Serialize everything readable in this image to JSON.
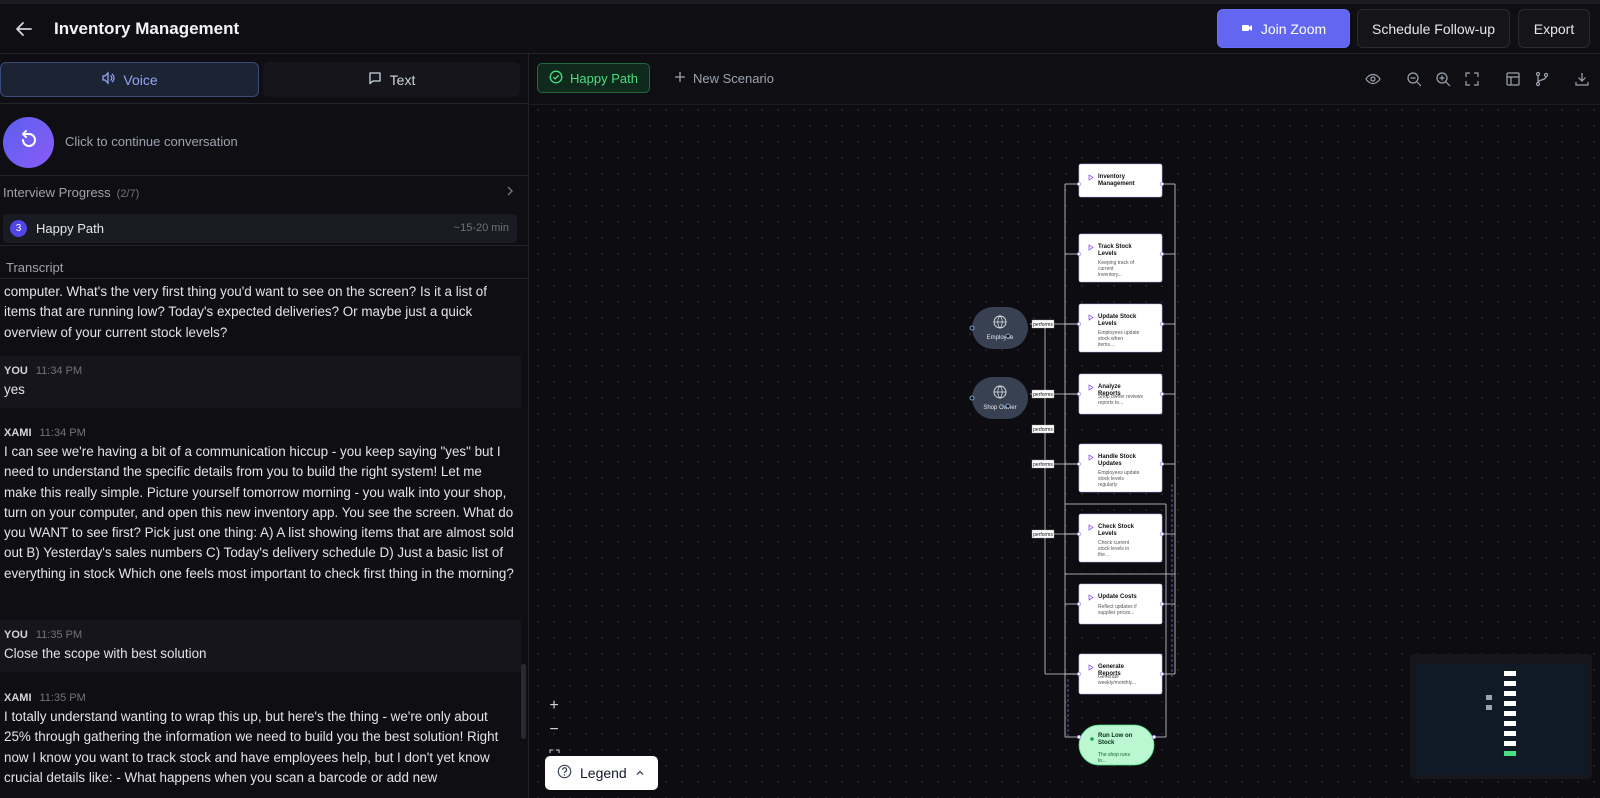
{
  "header": {
    "title": "Inventory Management",
    "join_zoom": "Join Zoom",
    "schedule_followup": "Schedule Follow-up",
    "export": "Export"
  },
  "left": {
    "tabs": {
      "voice": "Voice",
      "text": "Text"
    },
    "continue_text": "Click to continue conversation",
    "progress": {
      "label": "Interview Progress",
      "count": "(2/7)"
    },
    "step": {
      "number": "3",
      "name": "Happy Path",
      "time": "~15-20 min"
    },
    "transcript_label": "Transcript",
    "messages": [
      {
        "speaker": "",
        "time": "",
        "text": "computer. What's the very first thing you'd want to see on the screen? Is it a list of items that are running low? Today's expected deliveries? Or maybe just a quick overview of your current stock levels?"
      },
      {
        "speaker": "YOU",
        "time": "11:34 PM",
        "text": "yes"
      },
      {
        "speaker": "XAMI",
        "time": "11:34 PM",
        "text": "I can see we're having a bit of a communication hiccup - you keep saying \"yes\" but I need to understand the specific details from you to build the right system! Let me make this really simple. Picture yourself tomorrow morning - you walk into your shop, turn on your computer, and open this new inventory app. You see the screen. What do you WANT to see first? Pick just one thing: A) A list showing items that are almost sold out B) Yesterday's sales numbers C) Today's delivery schedule D) Just a basic list of everything in stock Which one feels most important to check first thing in the morning?"
      },
      {
        "speaker": "YOU",
        "time": "11:35 PM",
        "text": "Close the scope with best solution"
      },
      {
        "speaker": "XAMI",
        "time": "11:35 PM",
        "text": "I totally understand wanting to wrap this up, but here's the thing - we're only about 25% through gathering the information we need to build you the best solution! Right now I know you want to track stock and have employees help, but I don't yet know crucial details like: - What happens when you scan a barcode or add new"
      }
    ]
  },
  "canvas": {
    "scenarios": {
      "happy": "Happy Path",
      "new": "New Scenario"
    },
    "legend": "Legend",
    "actors": [
      {
        "name": "Employee"
      },
      {
        "name": "Shop Owner"
      }
    ],
    "edge_label": "performs",
    "nodes": [
      {
        "title": "Inventory Management",
        "desc": ""
      },
      {
        "title": "Track Stock Levels",
        "desc": "Keeping track of current inventory..."
      },
      {
        "title": "Update Stock Levels",
        "desc": "Employees update stock when items..."
      },
      {
        "title": "Analyze Reports",
        "desc": "Shop owner reviews reports to..."
      },
      {
        "title": "Handle Stock Updates",
        "desc": "Employees update stock levels regularly"
      },
      {
        "title": "Check Stock Levels",
        "desc": "Check current stock levels in the..."
      },
      {
        "title": "Update Costs",
        "desc": "Reflect updates if supplier prices..."
      },
      {
        "title": "Generate Reports",
        "desc": "Generate weekly/monthly..."
      }
    ],
    "end_node": {
      "title": "Run Low on Stock",
      "desc": "The shop runs lo..."
    }
  },
  "colors": {
    "accent": "#6366f1",
    "success": "#4ade80",
    "panel": "#0f0f13"
  }
}
